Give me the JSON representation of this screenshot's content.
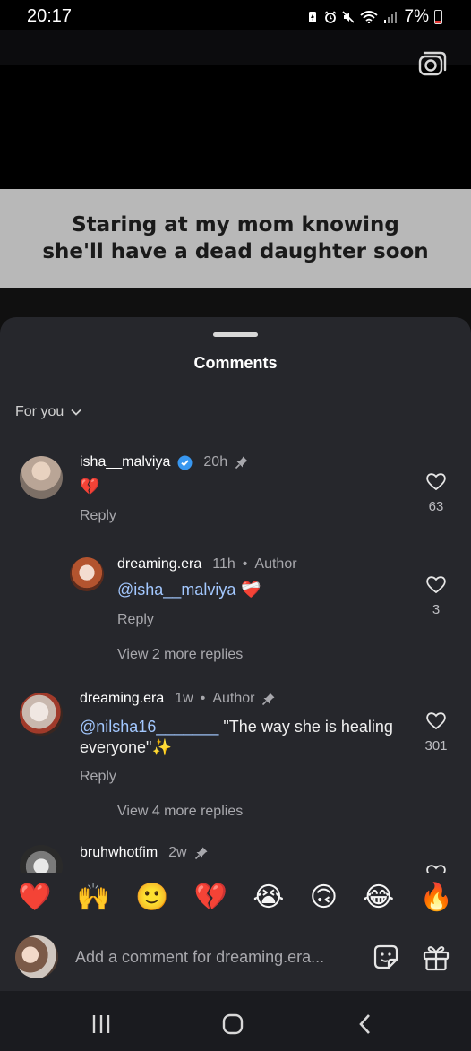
{
  "status_bar": {
    "time": "20:17",
    "battery": "7%"
  },
  "video": {
    "caption": "Staring at my mom knowing she'll have a dead daughter soon"
  },
  "sheet": {
    "title": "Comments",
    "sort_label": "For you"
  },
  "comments": [
    {
      "username": "isha__malviya",
      "verified": true,
      "time": "20h",
      "pinned": true,
      "text": "💔",
      "reply_label": "Reply",
      "likes": "63"
    },
    {
      "username": "dreaming.era",
      "time": "11h",
      "author_label": "Author",
      "mention": "@isha__malviya",
      "text": "❤️‍🩹",
      "reply_label": "Reply",
      "likes": "3",
      "view_more": "View 2 more replies"
    },
    {
      "username": "dreaming.era",
      "time": "1w",
      "author_label": "Author",
      "pinned": true,
      "mention": "@nilsha16_______",
      "text": " \"The way she is healing everyone\"✨",
      "reply_label": "Reply",
      "likes": "301",
      "view_more": "View 4 more replies"
    },
    {
      "username": "bruhwhotfim",
      "time": "2w",
      "pinned": true
    }
  ],
  "emoji_bar": [
    "❤️",
    "🙌",
    "🙂",
    "💔",
    "😭",
    "🙃",
    "😂",
    "🔥"
  ],
  "input": {
    "placeholder": "Add a comment for dreaming.era..."
  },
  "colors": {
    "sheet_bg": "#26272c",
    "mention": "#a3c8ff",
    "verified": "#3897f0",
    "caption_band": "#b8b8b8"
  }
}
